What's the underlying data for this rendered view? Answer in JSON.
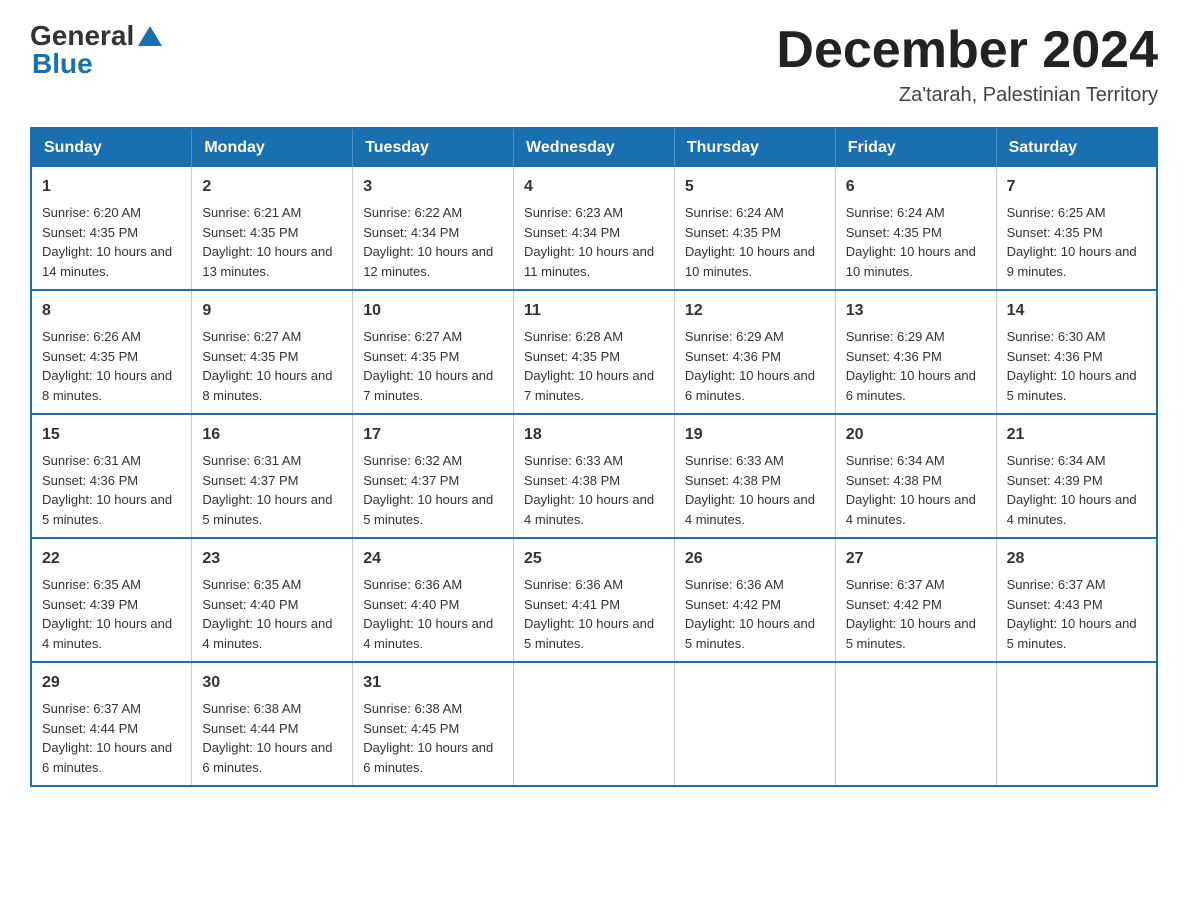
{
  "header": {
    "logo": {
      "general": "General",
      "blue": "Blue",
      "arrow_unicode": "▶"
    },
    "title": "December 2024",
    "location": "Za'tarah, Palestinian Territory"
  },
  "columns": [
    "Sunday",
    "Monday",
    "Tuesday",
    "Wednesday",
    "Thursday",
    "Friday",
    "Saturday"
  ],
  "weeks": [
    [
      {
        "day": "1",
        "sunrise": "Sunrise: 6:20 AM",
        "sunset": "Sunset: 4:35 PM",
        "daylight": "Daylight: 10 hours and 14 minutes."
      },
      {
        "day": "2",
        "sunrise": "Sunrise: 6:21 AM",
        "sunset": "Sunset: 4:35 PM",
        "daylight": "Daylight: 10 hours and 13 minutes."
      },
      {
        "day": "3",
        "sunrise": "Sunrise: 6:22 AM",
        "sunset": "Sunset: 4:34 PM",
        "daylight": "Daylight: 10 hours and 12 minutes."
      },
      {
        "day": "4",
        "sunrise": "Sunrise: 6:23 AM",
        "sunset": "Sunset: 4:34 PM",
        "daylight": "Daylight: 10 hours and 11 minutes."
      },
      {
        "day": "5",
        "sunrise": "Sunrise: 6:24 AM",
        "sunset": "Sunset: 4:35 PM",
        "daylight": "Daylight: 10 hours and 10 minutes."
      },
      {
        "day": "6",
        "sunrise": "Sunrise: 6:24 AM",
        "sunset": "Sunset: 4:35 PM",
        "daylight": "Daylight: 10 hours and 10 minutes."
      },
      {
        "day": "7",
        "sunrise": "Sunrise: 6:25 AM",
        "sunset": "Sunset: 4:35 PM",
        "daylight": "Daylight: 10 hours and 9 minutes."
      }
    ],
    [
      {
        "day": "8",
        "sunrise": "Sunrise: 6:26 AM",
        "sunset": "Sunset: 4:35 PM",
        "daylight": "Daylight: 10 hours and 8 minutes."
      },
      {
        "day": "9",
        "sunrise": "Sunrise: 6:27 AM",
        "sunset": "Sunset: 4:35 PM",
        "daylight": "Daylight: 10 hours and 8 minutes."
      },
      {
        "day": "10",
        "sunrise": "Sunrise: 6:27 AM",
        "sunset": "Sunset: 4:35 PM",
        "daylight": "Daylight: 10 hours and 7 minutes."
      },
      {
        "day": "11",
        "sunrise": "Sunrise: 6:28 AM",
        "sunset": "Sunset: 4:35 PM",
        "daylight": "Daylight: 10 hours and 7 minutes."
      },
      {
        "day": "12",
        "sunrise": "Sunrise: 6:29 AM",
        "sunset": "Sunset: 4:36 PM",
        "daylight": "Daylight: 10 hours and 6 minutes."
      },
      {
        "day": "13",
        "sunrise": "Sunrise: 6:29 AM",
        "sunset": "Sunset: 4:36 PM",
        "daylight": "Daylight: 10 hours and 6 minutes."
      },
      {
        "day": "14",
        "sunrise": "Sunrise: 6:30 AM",
        "sunset": "Sunset: 4:36 PM",
        "daylight": "Daylight: 10 hours and 5 minutes."
      }
    ],
    [
      {
        "day": "15",
        "sunrise": "Sunrise: 6:31 AM",
        "sunset": "Sunset: 4:36 PM",
        "daylight": "Daylight: 10 hours and 5 minutes."
      },
      {
        "day": "16",
        "sunrise": "Sunrise: 6:31 AM",
        "sunset": "Sunset: 4:37 PM",
        "daylight": "Daylight: 10 hours and 5 minutes."
      },
      {
        "day": "17",
        "sunrise": "Sunrise: 6:32 AM",
        "sunset": "Sunset: 4:37 PM",
        "daylight": "Daylight: 10 hours and 5 minutes."
      },
      {
        "day": "18",
        "sunrise": "Sunrise: 6:33 AM",
        "sunset": "Sunset: 4:38 PM",
        "daylight": "Daylight: 10 hours and 4 minutes."
      },
      {
        "day": "19",
        "sunrise": "Sunrise: 6:33 AM",
        "sunset": "Sunset: 4:38 PM",
        "daylight": "Daylight: 10 hours and 4 minutes."
      },
      {
        "day": "20",
        "sunrise": "Sunrise: 6:34 AM",
        "sunset": "Sunset: 4:38 PM",
        "daylight": "Daylight: 10 hours and 4 minutes."
      },
      {
        "day": "21",
        "sunrise": "Sunrise: 6:34 AM",
        "sunset": "Sunset: 4:39 PM",
        "daylight": "Daylight: 10 hours and 4 minutes."
      }
    ],
    [
      {
        "day": "22",
        "sunrise": "Sunrise: 6:35 AM",
        "sunset": "Sunset: 4:39 PM",
        "daylight": "Daylight: 10 hours and 4 minutes."
      },
      {
        "day": "23",
        "sunrise": "Sunrise: 6:35 AM",
        "sunset": "Sunset: 4:40 PM",
        "daylight": "Daylight: 10 hours and 4 minutes."
      },
      {
        "day": "24",
        "sunrise": "Sunrise: 6:36 AM",
        "sunset": "Sunset: 4:40 PM",
        "daylight": "Daylight: 10 hours and 4 minutes."
      },
      {
        "day": "25",
        "sunrise": "Sunrise: 6:36 AM",
        "sunset": "Sunset: 4:41 PM",
        "daylight": "Daylight: 10 hours and 5 minutes."
      },
      {
        "day": "26",
        "sunrise": "Sunrise: 6:36 AM",
        "sunset": "Sunset: 4:42 PM",
        "daylight": "Daylight: 10 hours and 5 minutes."
      },
      {
        "day": "27",
        "sunrise": "Sunrise: 6:37 AM",
        "sunset": "Sunset: 4:42 PM",
        "daylight": "Daylight: 10 hours and 5 minutes."
      },
      {
        "day": "28",
        "sunrise": "Sunrise: 6:37 AM",
        "sunset": "Sunset: 4:43 PM",
        "daylight": "Daylight: 10 hours and 5 minutes."
      }
    ],
    [
      {
        "day": "29",
        "sunrise": "Sunrise: 6:37 AM",
        "sunset": "Sunset: 4:44 PM",
        "daylight": "Daylight: 10 hours and 6 minutes."
      },
      {
        "day": "30",
        "sunrise": "Sunrise: 6:38 AM",
        "sunset": "Sunset: 4:44 PM",
        "daylight": "Daylight: 10 hours and 6 minutes."
      },
      {
        "day": "31",
        "sunrise": "Sunrise: 6:38 AM",
        "sunset": "Sunset: 4:45 PM",
        "daylight": "Daylight: 10 hours and 6 minutes."
      },
      null,
      null,
      null,
      null
    ]
  ]
}
